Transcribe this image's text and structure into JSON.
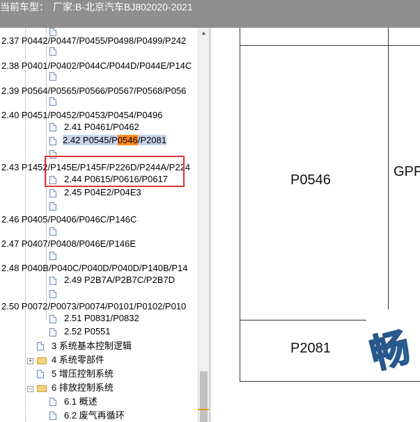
{
  "title_bar": {
    "label": "当前车型：",
    "value": "厂家:B-北京汽车BJ802020-2021"
  },
  "tree": {
    "items": [
      {
        "label": "2.37 P0442/P0447/P0455/P0498/P0499/P242"
      },
      {
        "label": "2.38 P0401/P0402/P044C/P044D/P044E/P14C"
      },
      {
        "label": "2.39 P0564/P0565/P0566/P0567/P0568/P056"
      },
      {
        "label": "2.40 P0451/P0452/P0453/P0454/P0496"
      },
      {
        "label": "2.41 P0461/P0462"
      },
      {
        "label_prefix": "2.42 P0545/P",
        "label_highlight": "0546",
        "label_suffix": "/P2081"
      },
      {
        "label": "2.43 P1452/P145E/P145F/P226D/P244A/P224"
      },
      {
        "label": "2.44 P0615/P0616/P0617"
      },
      {
        "label": "2.45 P04E2/P04E3"
      },
      {
        "label": "2.46 P0405/P0406/P046C/P146C"
      },
      {
        "label": "2.47 P0407/P0408/P046E/P146E"
      },
      {
        "label": "2.48 P040B/P040C/P040D/P040D/P140B/P14"
      },
      {
        "label": "2.49 P2B7A/P2B7C/P2B7D"
      },
      {
        "label": "2.50 P0072/P0073/P0074/P0101/P0102/P010"
      },
      {
        "label": "2.51 P0831/P0832"
      },
      {
        "label": "2.52 P0551"
      },
      {
        "label": "3 系统基本控制逻辑"
      },
      {
        "label": "4 系统零部件"
      },
      {
        "label": "5 增压控制系统"
      },
      {
        "label": "6 排放控制系统"
      },
      {
        "label": "6.1 概述"
      },
      {
        "label": "6.2 废气再循环"
      }
    ]
  },
  "content": {
    "cells": [
      "P0546",
      "P2081",
      "GPF"
    ],
    "watermark": "畅"
  }
}
